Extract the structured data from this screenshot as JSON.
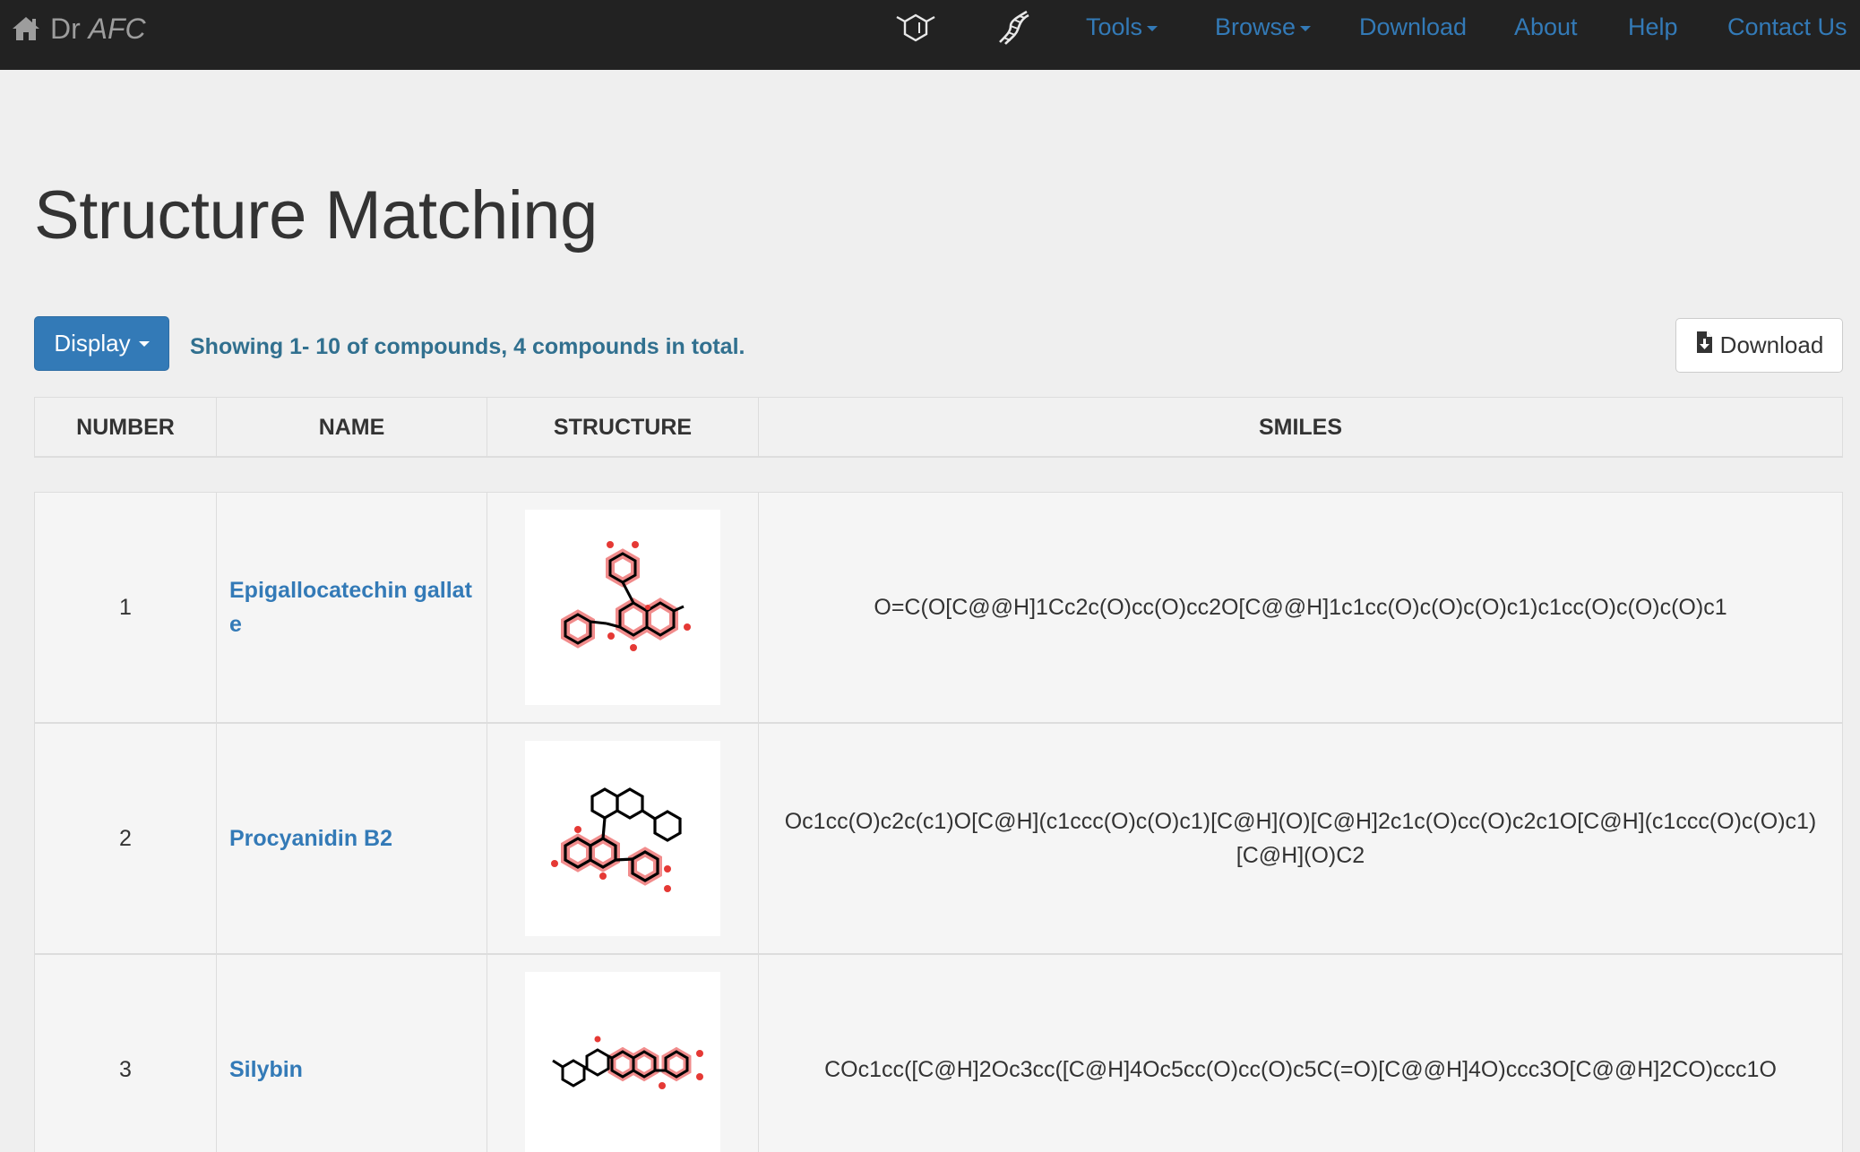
{
  "navbar": {
    "brand_prefix": "Dr ",
    "brand_suffix": "AFC",
    "links": {
      "tools": "Tools",
      "browse": "Browse",
      "download": "Download",
      "about": "About",
      "help": "Help",
      "contact": "Contact Us"
    }
  },
  "page": {
    "title": "Structure Matching"
  },
  "toolbar": {
    "display_label": "Display",
    "showing_text": "Showing 1- 10 of compounds, 4 compounds in total.",
    "download_label": "Download"
  },
  "table": {
    "headers": {
      "number": "NUMBER",
      "name": "NAME",
      "structure": "STRUCTURE",
      "smiles": "SMILES"
    },
    "rows": [
      {
        "number": "1",
        "name": "Epigallocatechin gallate",
        "smiles": "O=C(O[C@@H]1Cc2c(O)cc(O)cc2O[C@@H]1c1cc(O)c(O)c(O)c1)c1cc(O)c(O)c(O)c1"
      },
      {
        "number": "2",
        "name": "Procyanidin B2",
        "smiles": "Oc1cc(O)c2c(c1)O[C@H](c1ccc(O)c(O)c1)[C@H](O)[C@H]2c1c(O)cc(O)c2c1O[C@H](c1ccc(O)c(O)c1)[C@H](O)C2"
      },
      {
        "number": "3",
        "name": "Silybin",
        "smiles": "COc1cc([C@H]2Oc3cc([C@H]4Oc5cc(O)cc(O)c5C(=O)[C@@H]4O)ccc3O[C@@H]2CO)ccc1O"
      }
    ]
  },
  "colors": {
    "navbar_bg": "#222222",
    "link": "#337ab7",
    "primary_button": "#337ab7",
    "info_text": "#31708f",
    "highlight_atoms": "#f08080"
  }
}
